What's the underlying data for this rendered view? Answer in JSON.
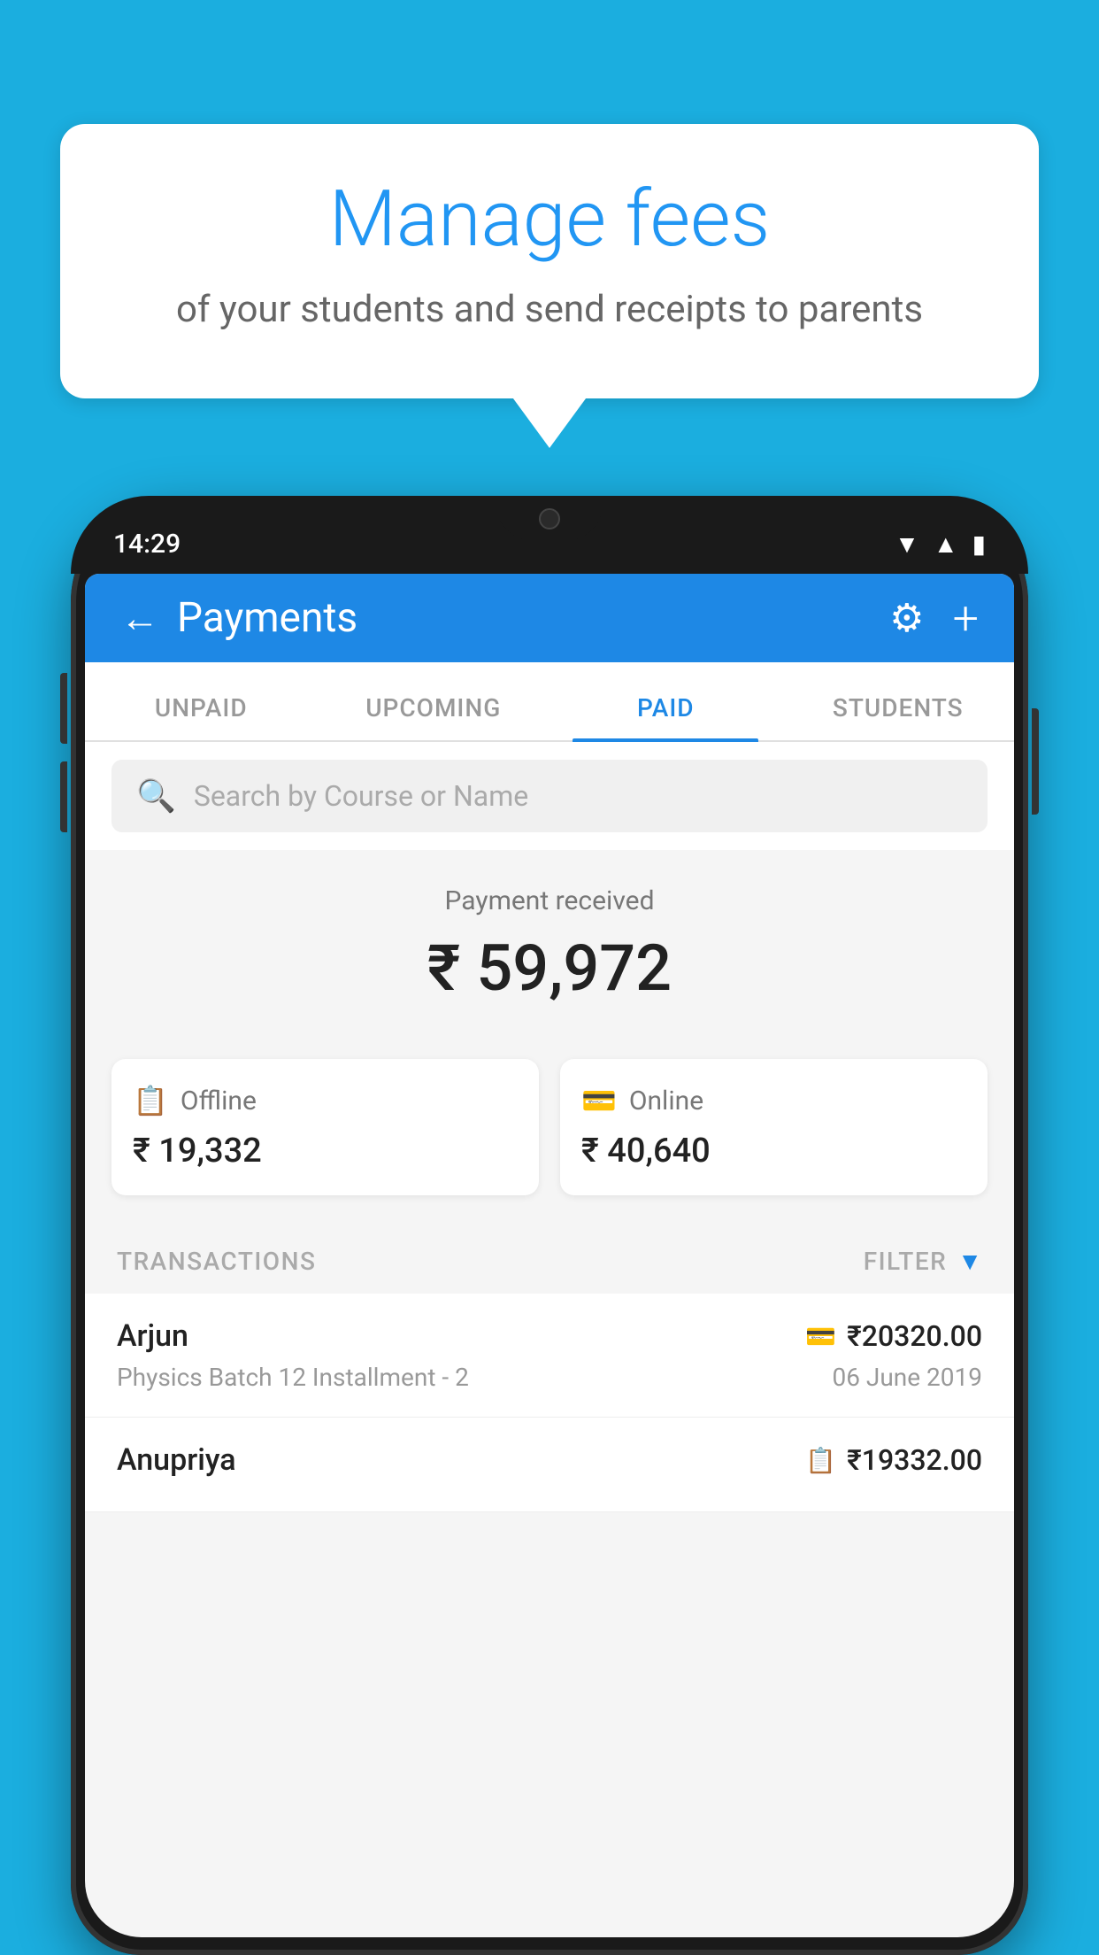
{
  "page": {
    "background_color": "#1BAEDF"
  },
  "bubble": {
    "title": "Manage fees",
    "subtitle": "of your students and send receipts to parents"
  },
  "status_bar": {
    "time": "14:29"
  },
  "header": {
    "title": "Payments",
    "back_label": "←",
    "gear_label": "⚙",
    "plus_label": "+"
  },
  "tabs": [
    {
      "id": "unpaid",
      "label": "UNPAID",
      "active": false
    },
    {
      "id": "upcoming",
      "label": "UPCOMING",
      "active": false
    },
    {
      "id": "paid",
      "label": "PAID",
      "active": true
    },
    {
      "id": "students",
      "label": "STUDENTS",
      "active": false
    }
  ],
  "search": {
    "placeholder": "Search by Course or Name"
  },
  "payment_received": {
    "label": "Payment received",
    "amount": "₹ 59,972"
  },
  "payment_cards": [
    {
      "id": "offline",
      "label": "Offline",
      "amount": "₹ 19,332",
      "icon": "💳"
    },
    {
      "id": "online",
      "label": "Online",
      "amount": "₹ 40,640",
      "icon": "💳"
    }
  ],
  "transactions": {
    "header_label": "TRANSACTIONS",
    "filter_label": "FILTER"
  },
  "transaction_list": [
    {
      "name": "Arjun",
      "amount": "₹20320.00",
      "course": "Physics Batch 12 Installment - 2",
      "date": "06 June 2019",
      "payment_type": "online"
    },
    {
      "name": "Anupriya",
      "amount": "₹19332.00",
      "course": "",
      "date": "",
      "payment_type": "offline"
    }
  ]
}
